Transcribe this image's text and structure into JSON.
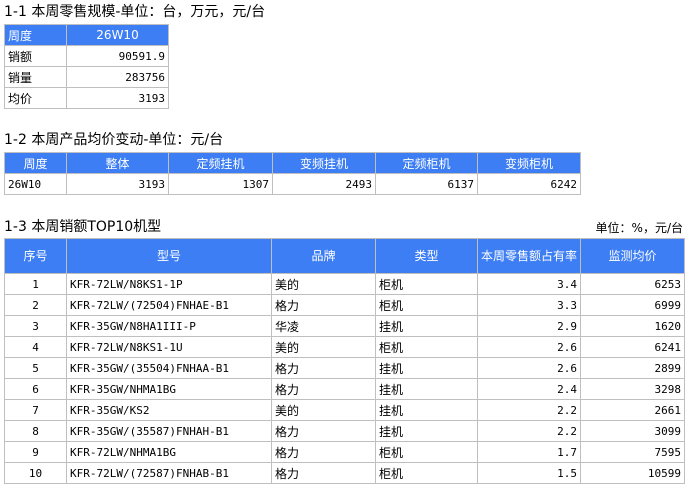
{
  "colors": {
    "header_bg": "#3d7ef5",
    "header_text": "#ffffff",
    "border": "#bfbfbf"
  },
  "section1": {
    "title": "1-1 本周零售规模-单位：台，万元，元/台",
    "header": {
      "label": "周度",
      "value": "26W10"
    },
    "rows": [
      {
        "label": "销额",
        "value": "90591.9"
      },
      {
        "label": "销量",
        "value": "283756"
      },
      {
        "label": "均价",
        "value": "3193"
      }
    ]
  },
  "section2": {
    "title": "1-2 本周产品均价变动-单位：元/台",
    "headers": [
      "周度",
      "整体",
      "定频挂机",
      "变频挂机",
      "定频柜机",
      "变频柜机"
    ],
    "row": [
      "26W10",
      "3193",
      "1307",
      "2493",
      "6137",
      "6242"
    ]
  },
  "section3": {
    "title": "1-3 本周销额TOP10机型",
    "unit_note": "单位：%，元/台",
    "headers": [
      "序号",
      "型号",
      "品牌",
      "类型",
      "本周零售额占有率",
      "监测均价"
    ],
    "rows": [
      [
        "1",
        "KFR-72LW/N8KS1-1P",
        "美的",
        "柜机",
        "3.4",
        "6253"
      ],
      [
        "2",
        "KFR-72LW/(72504)FNHAE-B1",
        "格力",
        "柜机",
        "3.3",
        "6999"
      ],
      [
        "3",
        "KFR-35GW/N8HA1III-P",
        "华凌",
        "挂机",
        "2.9",
        "1620"
      ],
      [
        "4",
        "KFR-72LW/N8KS1-1U",
        "美的",
        "柜机",
        "2.6",
        "6241"
      ],
      [
        "5",
        "KFR-35GW/(35504)FNHAA-B1",
        "格力",
        "挂机",
        "2.6",
        "2899"
      ],
      [
        "6",
        "KFR-35GW/NHMA1BG",
        "格力",
        "挂机",
        "2.4",
        "3298"
      ],
      [
        "7",
        "KFR-35GW/KS2",
        "美的",
        "挂机",
        "2.2",
        "2661"
      ],
      [
        "8",
        "KFR-35GW/(35587)FNHAH-B1",
        "格力",
        "挂机",
        "2.2",
        "3099"
      ],
      [
        "9",
        "KFR-72LW/NHMA1BG",
        "格力",
        "柜机",
        "1.7",
        "7595"
      ],
      [
        "10",
        "KFR-72LW/(72587)FNHAB-B1",
        "格力",
        "柜机",
        "1.5",
        "10599"
      ]
    ]
  }
}
